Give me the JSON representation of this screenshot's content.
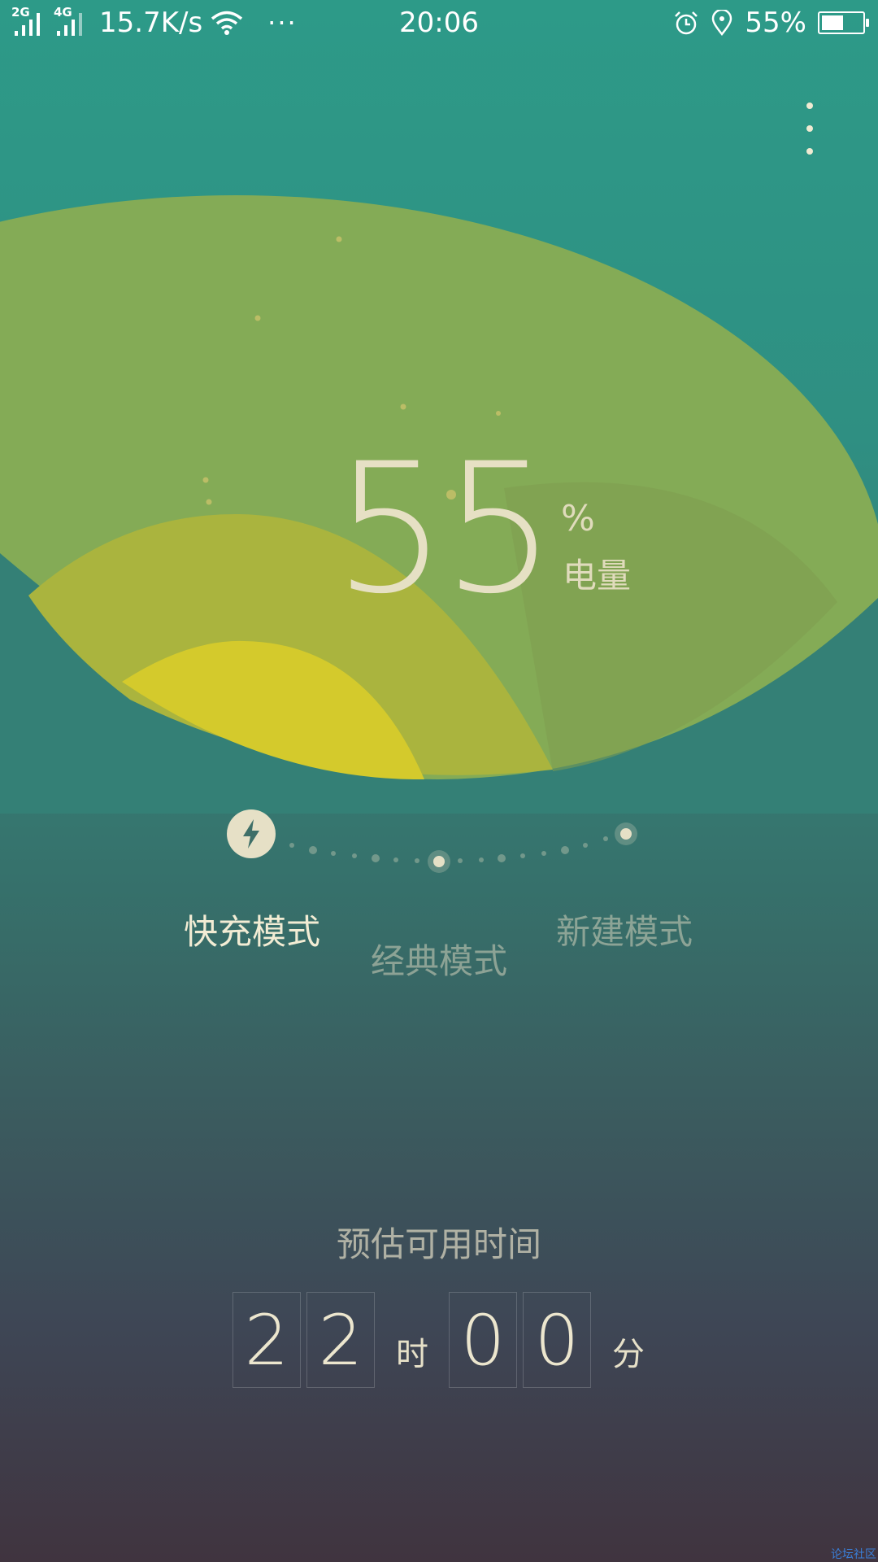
{
  "status_bar": {
    "net1": "2G",
    "net2": "4G",
    "speed": "15.7K/s",
    "more": "···",
    "time": "20:06",
    "battery_pct": "55%",
    "battery_level": 0.55
  },
  "battery": {
    "value": "55",
    "unit": "%",
    "label": "电量"
  },
  "modes": {
    "fast": "快充模式",
    "classic": "经典模式",
    "new": "新建模式"
  },
  "estimate": {
    "label": "预估可用时间",
    "hour_digits": [
      "2",
      "2"
    ],
    "hour_unit": "时",
    "minute_digits": [
      "0",
      "0"
    ],
    "minute_unit": "分"
  },
  "watermark": "论坛社区",
  "colors": {
    "accent_cream": "#e6e0c6",
    "green_outer": "#84ab56",
    "green_mid": "#aab43e",
    "yellow_inner": "#d4ca2c"
  }
}
